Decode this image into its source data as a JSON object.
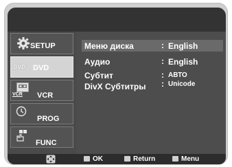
{
  "sidebar": {
    "items": [
      {
        "label": "SETUP",
        "icon": "gear-icon"
      },
      {
        "label": "DVD",
        "icon": "dvd-logo-icon",
        "badge": "DVD"
      },
      {
        "label": "VCR",
        "icon": "vcr-tape-icon",
        "badge": "VCR"
      },
      {
        "label": "PROG",
        "icon": "clock-icon"
      },
      {
        "label": "FUNC",
        "icon": "hand-icon"
      }
    ]
  },
  "menu": {
    "rows": [
      {
        "label": "Меню диска",
        "separator": ":",
        "value": "English"
      },
      {
        "label": "Аудио",
        "separator": ":",
        "value": "English"
      },
      {
        "label": "Субтит",
        "separator": ":",
        "value": "АВТО"
      },
      {
        "label": "DivX Субтитры",
        "separator": ":",
        "value": "Unicode"
      }
    ]
  },
  "footer": {
    "nav_icon": "dpad-icon",
    "ok_label": "OK",
    "return_label": "Return",
    "menu_label": "Menu"
  },
  "colors": {
    "accent_highlight": "#6a6a6a",
    "active_sidebar": "#d4d4d4"
  }
}
